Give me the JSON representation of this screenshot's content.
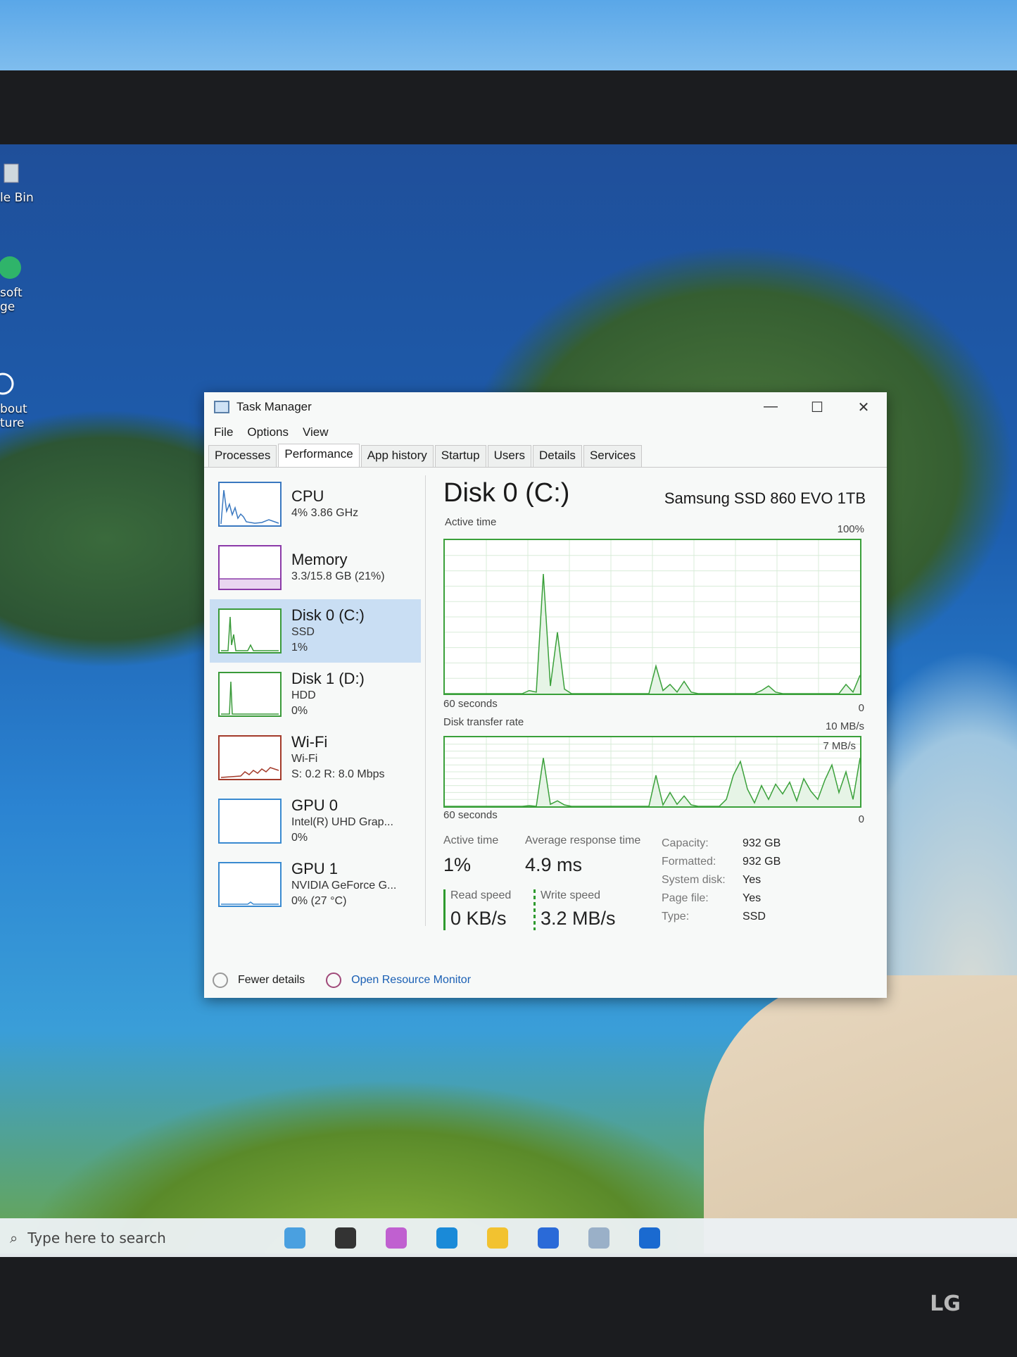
{
  "desktop": {
    "icons": [
      {
        "label": "le Bin",
        "icon": "recycle-bin-icon"
      },
      {
        "label": "soft\nge",
        "icon": "edge-icon"
      },
      {
        "label": "bout\nture",
        "icon": "info-icon"
      }
    ]
  },
  "window": {
    "title": "Task Manager",
    "buttons": {
      "minimize": "—",
      "maximize": "☐",
      "close": "✕"
    }
  },
  "menu": [
    "File",
    "Options",
    "View"
  ],
  "tabs": [
    "Processes",
    "Performance",
    "App history",
    "Startup",
    "Users",
    "Details",
    "Services"
  ],
  "active_tab": "Performance",
  "sidebar": [
    {
      "name": "CPU",
      "lines": [
        "4% 3.86 GHz"
      ],
      "color": "#3a78c0",
      "active": false
    },
    {
      "name": "Memory",
      "lines": [
        "3.3/15.8 GB (21%)"
      ],
      "color": "#8b3aa8",
      "active": false
    },
    {
      "name": "Disk 0 (C:)",
      "lines": [
        "SSD",
        "1%"
      ],
      "color": "#3a9a3a",
      "active": true
    },
    {
      "name": "Disk 1 (D:)",
      "lines": [
        "HDD",
        "0%"
      ],
      "color": "#3a9a3a",
      "active": false
    },
    {
      "name": "Wi-Fi",
      "lines": [
        "Wi-Fi",
        "S: 0.2 R: 8.0 Mbps"
      ],
      "color": "#a33a2a",
      "active": false
    },
    {
      "name": "GPU 0",
      "lines": [
        "Intel(R) UHD Grap...",
        "0%"
      ],
      "color": "#3a8ad0",
      "active": false
    },
    {
      "name": "GPU 1",
      "lines": [
        "NVIDIA GeForce G...",
        "0% (27 °C)"
      ],
      "color": "#3a8ad0",
      "active": false
    }
  ],
  "detail": {
    "title": "Disk 0 (C:)",
    "model": "Samsung SSD 860 EVO 1TB",
    "active_time_graph": {
      "label": "Active time",
      "max": "100%",
      "xlabel": "60 seconds",
      "min": "0"
    },
    "transfer_graph": {
      "label": "Disk transfer rate",
      "max": "10 MB/s",
      "inner_max": "7 MB/s",
      "xlabel": "60 seconds",
      "min": "0"
    },
    "stats": {
      "active_time_label": "Active time",
      "active_time": "1%",
      "avg_response_label": "Average response time",
      "avg_response": "4.9 ms",
      "read_label": "Read speed",
      "read": "0 KB/s",
      "write_label": "Write speed",
      "write": "3.2 MB/s"
    },
    "props": [
      {
        "k": "Capacity:",
        "v": "932 GB"
      },
      {
        "k": "Formatted:",
        "v": "932 GB"
      },
      {
        "k": "System disk:",
        "v": "Yes"
      },
      {
        "k": "Page file:",
        "v": "Yes"
      },
      {
        "k": "Type:",
        "v": "SSD"
      }
    ]
  },
  "footer": {
    "fewer": "Fewer details",
    "monitor": "Open Resource Monitor"
  },
  "taskbar": {
    "search_placeholder": "Type here to search",
    "apps": [
      {
        "icon": "widgets-icon",
        "color": "#4aa0e0"
      },
      {
        "icon": "task-view-icon",
        "color": "#333333"
      },
      {
        "icon": "copilot-icon",
        "color": "#c060d0"
      },
      {
        "icon": "edge-icon",
        "color": "#1a8ad8"
      },
      {
        "icon": "file-explorer-icon",
        "color": "#f2c230"
      },
      {
        "icon": "store-icon",
        "color": "#2a6ad8"
      },
      {
        "icon": "task-manager-icon",
        "color": "#9ab0c8"
      },
      {
        "icon": "outlook-icon",
        "color": "#1a6ad0"
      }
    ]
  },
  "monitor_brand": "LG",
  "series": {
    "active_time": [
      0,
      0,
      0,
      0,
      0,
      0,
      0,
      0,
      0,
      0,
      0,
      0,
      2,
      1,
      78,
      5,
      40,
      3,
      0,
      0,
      0,
      0,
      0,
      0,
      0,
      0,
      0,
      0,
      0,
      0,
      18,
      2,
      6,
      1,
      8,
      1,
      0,
      0,
      0,
      0,
      0,
      0,
      0,
      0,
      0,
      2,
      5,
      1,
      0,
      0,
      0,
      0,
      0,
      0,
      0,
      0,
      0,
      6,
      1,
      12
    ],
    "transfer": [
      0,
      0,
      0,
      0,
      0,
      0,
      0,
      0,
      0,
      0,
      0,
      0,
      1,
      0,
      70,
      3,
      8,
      2,
      0,
      0,
      0,
      0,
      0,
      0,
      0,
      0,
      0,
      0,
      0,
      0,
      45,
      2,
      20,
      3,
      15,
      2,
      0,
      0,
      0,
      0,
      10,
      45,
      65,
      25,
      5,
      30,
      10,
      32,
      18,
      35,
      8,
      40,
      22,
      10,
      38,
      60,
      20,
      50,
      10,
      70
    ]
  }
}
